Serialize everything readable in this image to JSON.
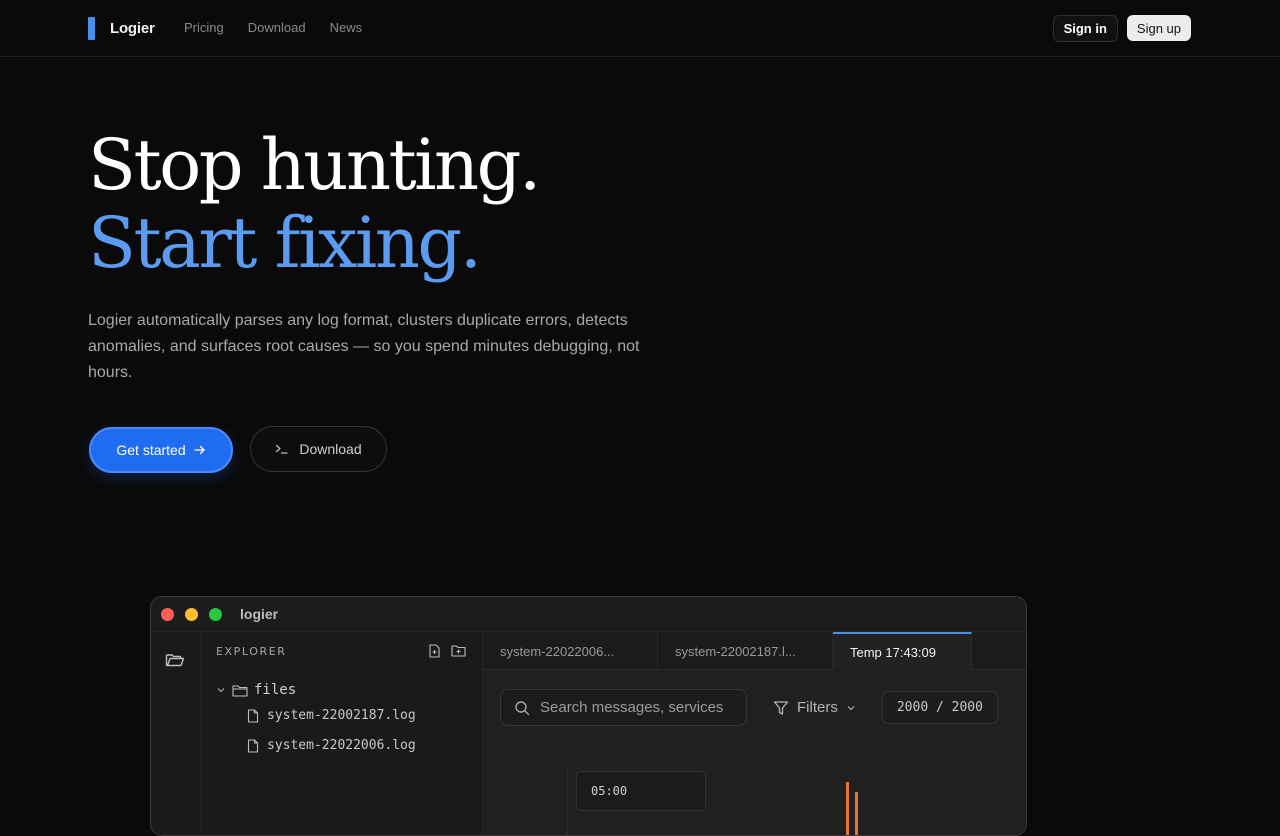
{
  "header": {
    "brand": "Logier",
    "nav": [
      "Pricing",
      "Download",
      "News"
    ],
    "sign_in": "Sign in",
    "sign_up": "Sign up"
  },
  "hero": {
    "title_line1": "Stop hunting.",
    "title_line2": "Start fixing.",
    "description": "Logier automatically parses any log format, clusters duplicate errors, detects anomalies, and surfaces root causes — so you spend minutes debugging, not hours.",
    "cta_primary": "Get started",
    "cta_secondary": "Download",
    "accent_color": "#5b9cf2",
    "primary_button_color": "#1f6cf0"
  },
  "app_window": {
    "title": "logier",
    "explorer": {
      "heading": "EXPLORER",
      "folder": "files",
      "files": [
        "system-22002187.log",
        "system-22022006.log"
      ]
    },
    "tabs": [
      {
        "label": "system-22022006...",
        "active": false
      },
      {
        "label": "system-22002187.l...",
        "active": false
      },
      {
        "label": "Temp 17:43:09",
        "active": true
      }
    ],
    "search_placeholder": "Search messages, services",
    "filters_label": "Filters",
    "counter": "2000 / 2000",
    "time_label": "05:00"
  }
}
